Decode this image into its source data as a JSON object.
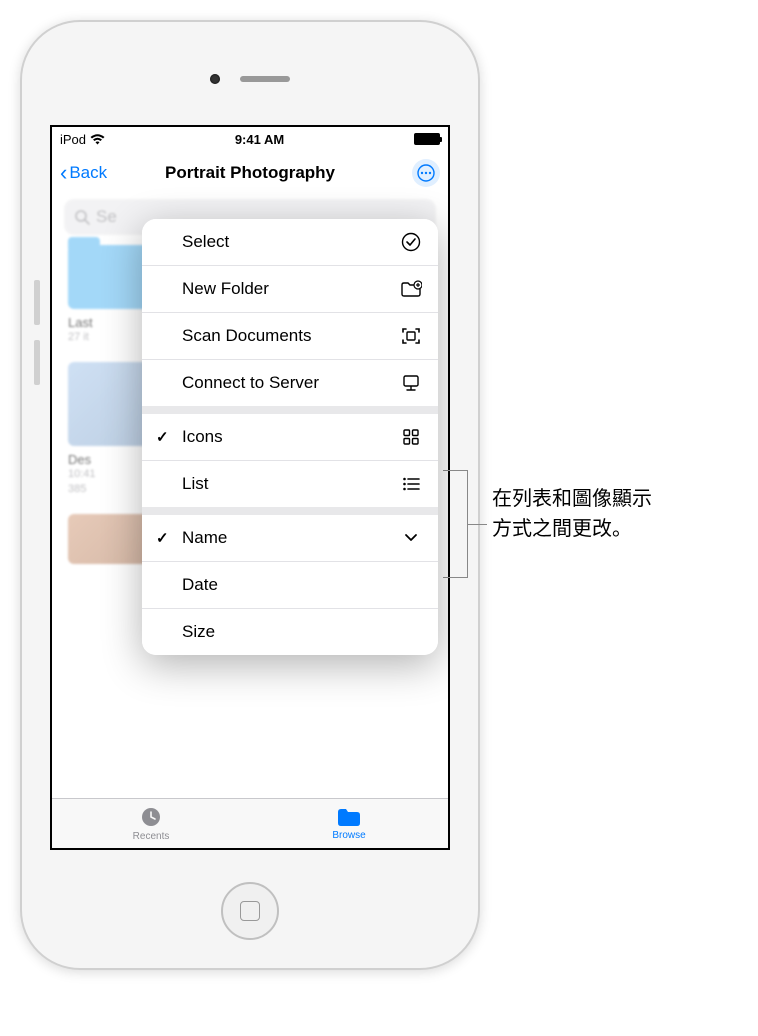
{
  "status": {
    "carrier": "iPod",
    "time": "9:41 AM"
  },
  "nav": {
    "back_label": "Back",
    "title": "Portrait Photography"
  },
  "search": {
    "placeholder": "Search",
    "visible_text": "Se"
  },
  "grid": {
    "item0_name": "Last",
    "item0_meta": "27 it",
    "item1_name": "Des",
    "item1_meta1": "10:41",
    "item1_meta2": "385"
  },
  "menu": {
    "select": "Select",
    "new_folder": "New Folder",
    "scan_documents": "Scan Documents",
    "connect_server": "Connect to Server",
    "icons": "Icons",
    "list": "List",
    "name": "Name",
    "date": "Date",
    "size": "Size"
  },
  "tabs": {
    "recents": "Recents",
    "browse": "Browse"
  },
  "annotation": {
    "line1": "在列表和圖像顯示",
    "line2": "方式之間更改。"
  }
}
